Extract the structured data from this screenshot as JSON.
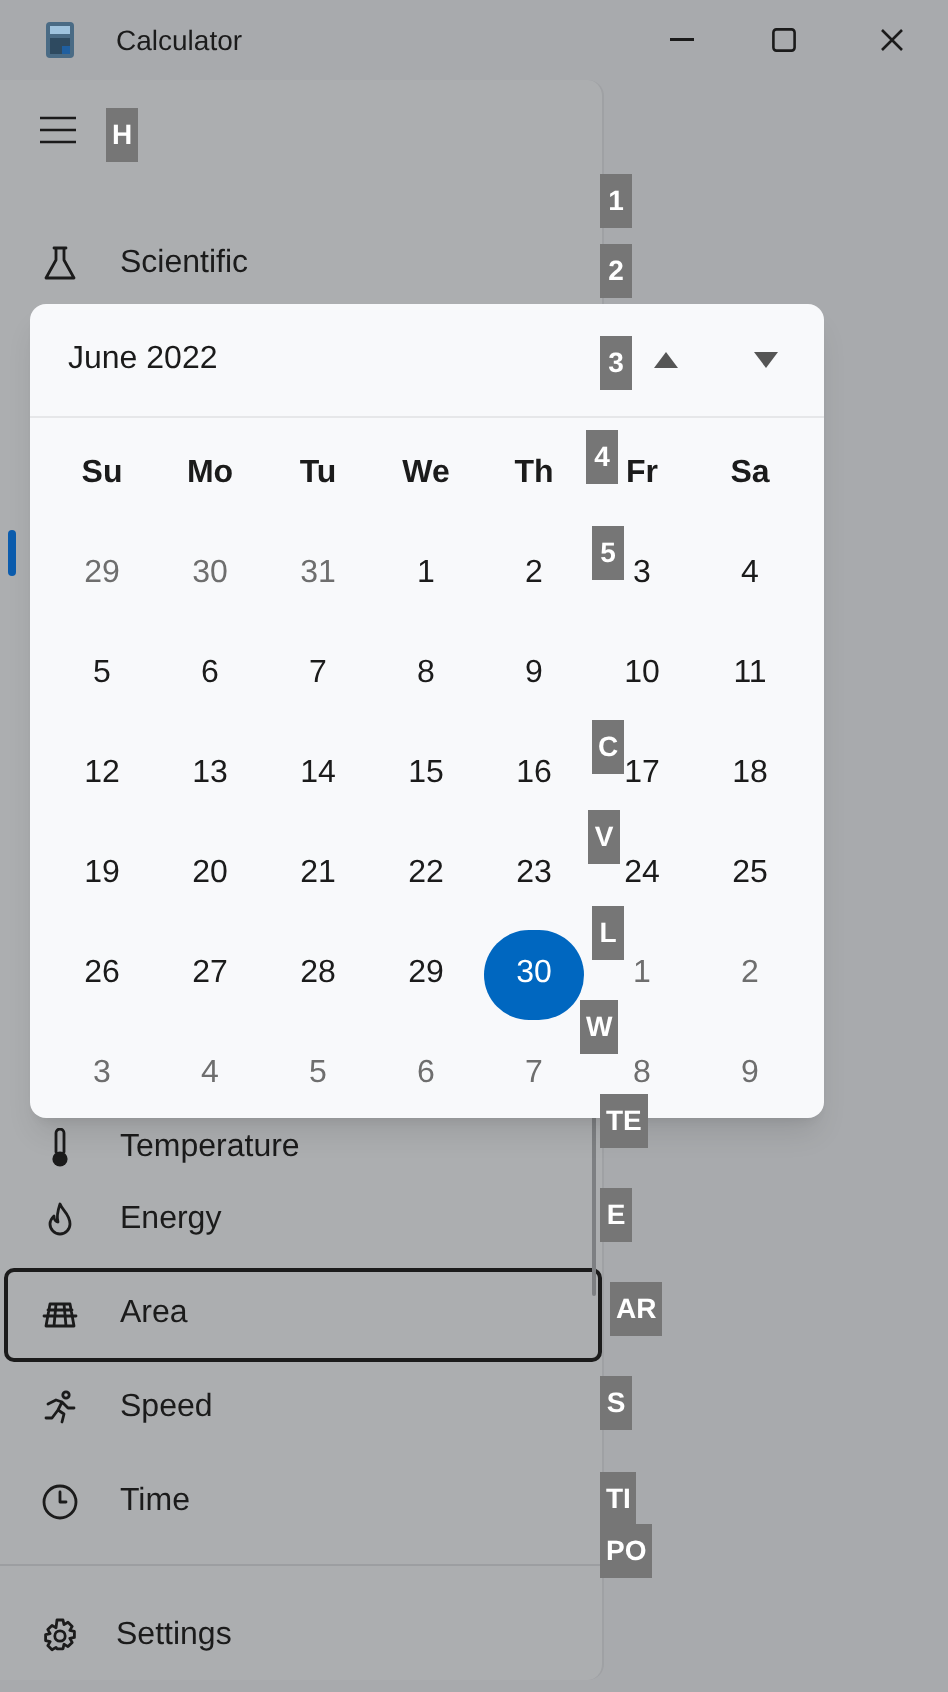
{
  "window": {
    "title": "Calculator"
  },
  "nav": {
    "top_items": [
      {
        "label": "Scientific",
        "focused": false
      }
    ],
    "bottom_items": [
      {
        "label": "Temperature",
        "focused": false
      },
      {
        "label": "Energy",
        "focused": false
      },
      {
        "label": "Area",
        "focused": true
      },
      {
        "label": "Speed",
        "focused": false
      },
      {
        "label": "Time",
        "focused": false
      }
    ],
    "settings": {
      "label": "Settings"
    }
  },
  "calendar": {
    "month": "June 2022",
    "weekdays": [
      "Su",
      "Mo",
      "Tu",
      "We",
      "Th",
      "Fr",
      "Sa"
    ],
    "days": [
      {
        "label": "29",
        "in_month": false,
        "selected": false
      },
      {
        "label": "30",
        "in_month": false,
        "selected": false
      },
      {
        "label": "31",
        "in_month": false,
        "selected": false
      },
      {
        "label": "1",
        "in_month": true,
        "selected": false
      },
      {
        "label": "2",
        "in_month": true,
        "selected": false
      },
      {
        "label": "3",
        "in_month": true,
        "selected": false
      },
      {
        "label": "4",
        "in_month": true,
        "selected": false
      },
      {
        "label": "5",
        "in_month": true,
        "selected": false
      },
      {
        "label": "6",
        "in_month": true,
        "selected": false
      },
      {
        "label": "7",
        "in_month": true,
        "selected": false
      },
      {
        "label": "8",
        "in_month": true,
        "selected": false
      },
      {
        "label": "9",
        "in_month": true,
        "selected": false
      },
      {
        "label": "10",
        "in_month": true,
        "selected": false
      },
      {
        "label": "11",
        "in_month": true,
        "selected": false
      },
      {
        "label": "12",
        "in_month": true,
        "selected": false
      },
      {
        "label": "13",
        "in_month": true,
        "selected": false
      },
      {
        "label": "14",
        "in_month": true,
        "selected": false
      },
      {
        "label": "15",
        "in_month": true,
        "selected": false
      },
      {
        "label": "16",
        "in_month": true,
        "selected": false
      },
      {
        "label": "17",
        "in_month": true,
        "selected": false
      },
      {
        "label": "18",
        "in_month": true,
        "selected": false
      },
      {
        "label": "19",
        "in_month": true,
        "selected": false
      },
      {
        "label": "20",
        "in_month": true,
        "selected": false
      },
      {
        "label": "21",
        "in_month": true,
        "selected": false
      },
      {
        "label": "22",
        "in_month": true,
        "selected": false
      },
      {
        "label": "23",
        "in_month": true,
        "selected": false
      },
      {
        "label": "24",
        "in_month": true,
        "selected": false
      },
      {
        "label": "25",
        "in_month": true,
        "selected": false
      },
      {
        "label": "26",
        "in_month": true,
        "selected": false
      },
      {
        "label": "27",
        "in_month": true,
        "selected": false
      },
      {
        "label": "28",
        "in_month": true,
        "selected": false
      },
      {
        "label": "29",
        "in_month": true,
        "selected": false
      },
      {
        "label": "30",
        "in_month": true,
        "selected": true
      },
      {
        "label": "1",
        "in_month": false,
        "selected": false
      },
      {
        "label": "2",
        "in_month": false,
        "selected": false
      },
      {
        "label": "3",
        "in_month": false,
        "selected": false
      },
      {
        "label": "4",
        "in_month": false,
        "selected": false
      },
      {
        "label": "5",
        "in_month": false,
        "selected": false
      },
      {
        "label": "6",
        "in_month": false,
        "selected": false
      },
      {
        "label": "7",
        "in_month": false,
        "selected": false
      },
      {
        "label": "8",
        "in_month": false,
        "selected": false
      },
      {
        "label": "9",
        "in_month": false,
        "selected": false
      }
    ]
  },
  "keytips": [
    "H",
    "1",
    "2",
    "3",
    "4",
    "5",
    "C",
    "V",
    "L",
    "W",
    "TE",
    "E",
    "AR",
    "S",
    "TI",
    "PO"
  ]
}
